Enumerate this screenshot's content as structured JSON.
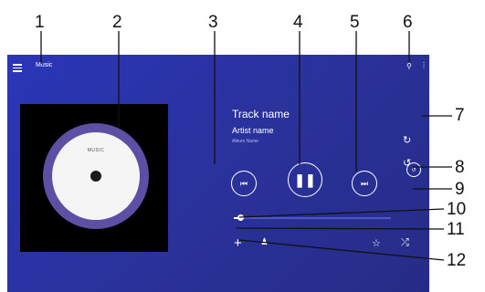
{
  "callouts": [
    "1",
    "2",
    "3",
    "4",
    "5",
    "6",
    "7",
    "8",
    "9",
    "10",
    "11",
    "12"
  ],
  "app": {
    "title": "Music"
  },
  "album_art": {
    "disc_title": "MUSIC",
    "disc_left": "",
    "disc_right": "",
    "disc_bottom": ""
  },
  "track": {
    "name": "Track name",
    "artist": "Artist name",
    "album": "Album Name"
  },
  "playback": {
    "progress": 0.04,
    "time": ""
  },
  "icons": {
    "menu": "menu-icon",
    "search": "search-icon",
    "more": "more-vert-icon",
    "prev": "skip-previous-icon",
    "play_pause": "pause-icon",
    "next": "skip-next-icon",
    "sync": "sync-icon",
    "repeat": "repeat-icon",
    "shuffle_toggle": "repeat-toggle-icon",
    "add": "add-icon",
    "artist": "person-icon",
    "favorite": "star-icon",
    "shuffle": "shuffle-icon"
  },
  "colors": {
    "background": "#2a36b8",
    "accent": "#5d4fa4",
    "text": "#ffffff"
  }
}
